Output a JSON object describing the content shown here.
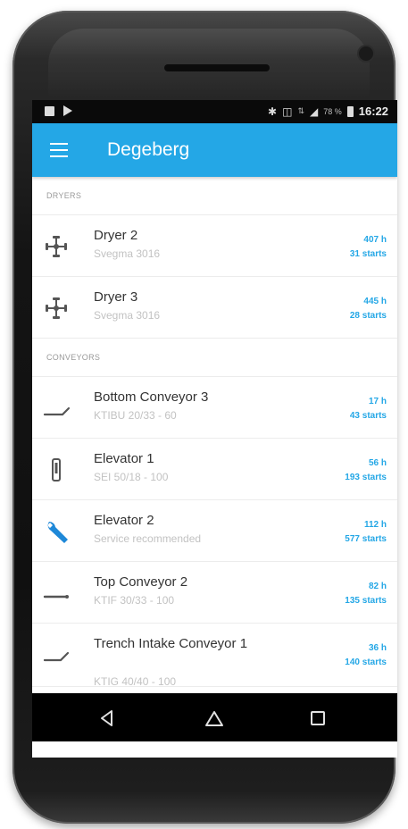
{
  "status_bar": {
    "time": "16:22",
    "battery": "78 %",
    "icons": [
      "image-icon",
      "play-store-icon",
      "bluetooth-icon",
      "vibrate-icon",
      "data-icon",
      "signal-icon",
      "battery-icon"
    ]
  },
  "app_bar": {
    "title": "Degeberg",
    "color": "#24a7e6"
  },
  "sections": {
    "dryers": {
      "header": "DRYERS",
      "items": [
        {
          "title": "Dryer 2",
          "subtitle": "Svegma 3016",
          "hours": "407 h",
          "starts": "31 starts",
          "icon": "fan-icon"
        },
        {
          "title": "Dryer 3",
          "subtitle": "Svegma 3016",
          "hours": "445 h",
          "starts": "28 starts",
          "icon": "fan-icon"
        }
      ]
    },
    "conveyors": {
      "header": "CONVEYORS",
      "items": [
        {
          "title": "Bottom Conveyor 3",
          "subtitle": "KTIBU 20/33 - 60",
          "hours": "17 h",
          "starts": "43 starts",
          "icon": "inclined-conveyor-icon"
        },
        {
          "title": "Elevator 1",
          "subtitle": "SEI 50/18 - 100",
          "hours": "56 h",
          "starts": "193 starts",
          "icon": "elevator-icon"
        },
        {
          "title": "Elevator 2",
          "subtitle": "Service recommended",
          "hours": "112 h",
          "starts": "577 starts",
          "icon": "wrench-icon"
        },
        {
          "title": "Top Conveyor 2",
          "subtitle": "KTIF 30/33 - 100",
          "hours": "82 h",
          "starts": "135 starts",
          "icon": "flat-conveyor-icon"
        },
        {
          "title": "Trench Intake Conveyor 1",
          "subtitle": "KTIG 40/40 - 100",
          "hours": "36 h",
          "starts": "140 starts",
          "icon": "intake-conveyor-icon"
        }
      ]
    }
  },
  "nav_bar": {
    "buttons": [
      "back-icon",
      "home-icon",
      "recents-icon"
    ]
  }
}
